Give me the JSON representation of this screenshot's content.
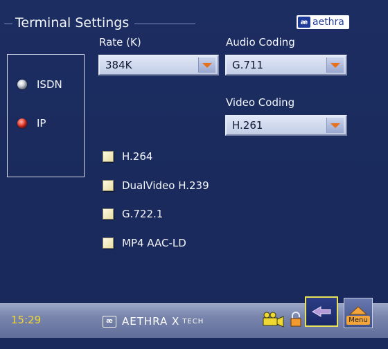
{
  "header": {
    "title": "Terminal Settings",
    "logo_text": "aethra"
  },
  "connection": {
    "options": [
      {
        "label": "ISDN",
        "selected": false
      },
      {
        "label": "IP",
        "selected": true
      }
    ]
  },
  "rate": {
    "label": "Rate (K)",
    "value": "384K"
  },
  "audio_coding": {
    "label": "Audio Coding",
    "value": "G.711"
  },
  "video_coding": {
    "label": "Video Coding",
    "value": "H.261"
  },
  "options": [
    {
      "label": "H.264",
      "checked": false
    },
    {
      "label": "DualVideo H.239",
      "checked": false
    },
    {
      "label": "G.722.1",
      "checked": false
    },
    {
      "label": "MP4 AAC-LD",
      "checked": false
    }
  ],
  "status_bar": {
    "time": "15:29",
    "brand_name": "AETHRA X",
    "brand_suffix": "TECH",
    "menu_label": "Menu"
  },
  "colors": {
    "background": "#1a2b5e",
    "clock": "#f0d832",
    "radio_selected": "#e22a1c",
    "dropdown_arrow": "#e8701a",
    "back_button_border": "#e7e35a"
  },
  "icons": {
    "camera": "camera-icon",
    "lock": "lock-icon",
    "back": "back-arrow-icon",
    "menu": "home-menu-icon"
  }
}
